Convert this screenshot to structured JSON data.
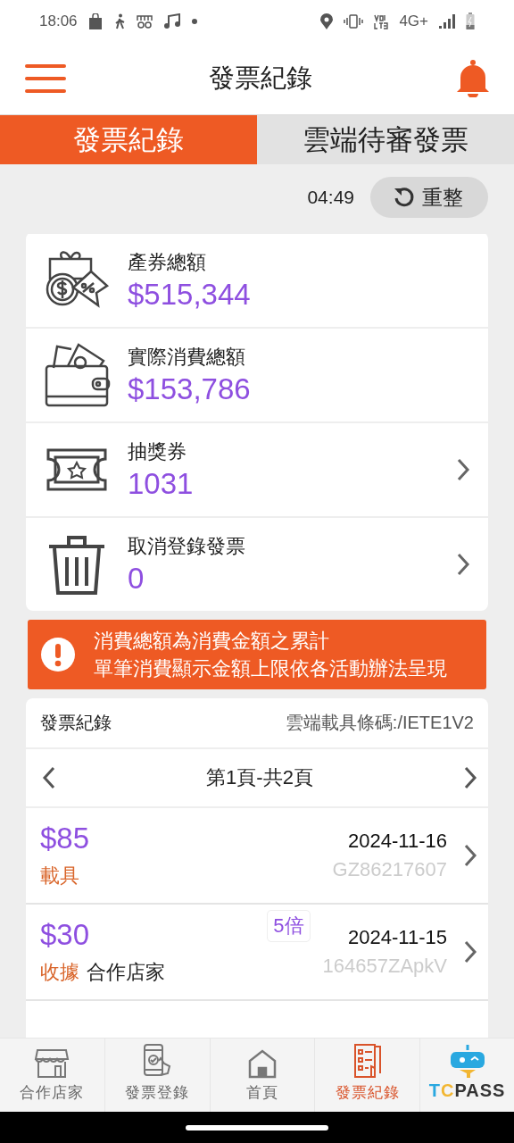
{
  "status_bar": {
    "time": "18:06",
    "network": "4G+"
  },
  "header": {
    "title": "發票紀錄"
  },
  "tabs": [
    {
      "label": "發票紀錄",
      "selected": true
    },
    {
      "label": "雲端待審發票",
      "selected": false
    }
  ],
  "refresh": {
    "countdown": "04:49",
    "button": "重整"
  },
  "summary": [
    {
      "kind": "coupon",
      "label": "產券總額",
      "value": "$515,344",
      "has_arrow": false
    },
    {
      "kind": "wallet",
      "label": "實際消費總額",
      "value": "$153,786",
      "has_arrow": false
    },
    {
      "kind": "ticket",
      "label": "抽獎券",
      "value": "1031",
      "has_arrow": true
    },
    {
      "kind": "trash",
      "label": "取消登錄發票",
      "value": "0",
      "has_arrow": true
    }
  ],
  "notice": {
    "lines": [
      "消費總額為消費金額之累計",
      "單筆消費顯示金額上限依各活動辦法呈現"
    ]
  },
  "invoices": {
    "title": "發票紀錄",
    "carrier": "雲端載具條碼:/IETE1V2",
    "page": "第1頁-共2頁",
    "rows": [
      {
        "amount": "$85",
        "type": "載具",
        "date": "2024-11-16",
        "number": "GZ86217607"
      },
      {
        "amount": "$30",
        "type": "收據",
        "store": "合作店家",
        "badge": "5倍",
        "date": "2024-11-15",
        "number": "164657ZApkV"
      }
    ]
  },
  "bottom_nav": [
    {
      "kind": "shop",
      "label": "合作店家",
      "selected": false
    },
    {
      "kind": "phone",
      "label": "發票登錄",
      "selected": false
    },
    {
      "kind": "home",
      "label": "首頁",
      "selected": false
    },
    {
      "kind": "receipt",
      "label": "發票紀錄",
      "selected": true
    }
  ],
  "logo": [
    {
      "text": "T",
      "color": "#29a8e0"
    },
    {
      "text": "C",
      "color": "#f2b632"
    },
    {
      "text": "PASS",
      "color": "#333333"
    }
  ]
}
